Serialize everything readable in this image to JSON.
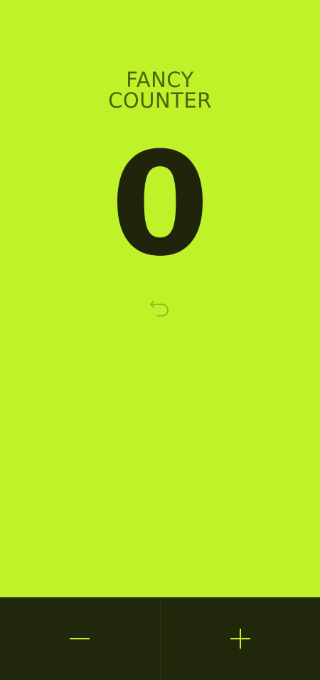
{
  "app": {
    "title_line1": "FANCY",
    "title_line2": "COUNTER",
    "count": "0"
  },
  "icons": {
    "reset": "undo-arrow-icon",
    "decrement": "minus-icon",
    "increment": "plus-icon"
  },
  "colors": {
    "background": "#bff229",
    "title": "#4c640c",
    "count": "#1f240b",
    "control_bar": "#20270b",
    "control_icon": "#bff229",
    "reset_icon": "#8fbd22"
  }
}
